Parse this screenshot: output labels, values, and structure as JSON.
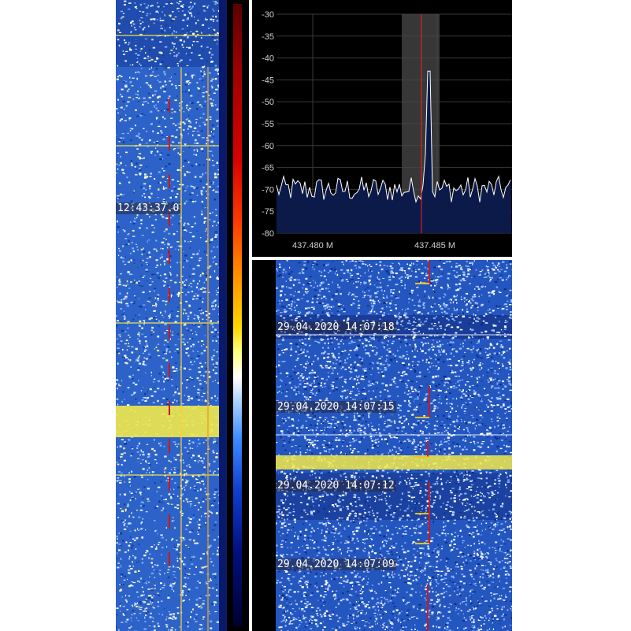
{
  "left_waterfall": {
    "timestamp": "12:43:37.0"
  },
  "spectrum": {
    "y_ticks": [
      "-30",
      "-35",
      "-40",
      "-45",
      "-50",
      "-55",
      "-60",
      "-65",
      "-70",
      "-75",
      "-80"
    ],
    "x_ticks": [
      "437.480 M",
      "437.485 M"
    ],
    "colors": {
      "background": "#000000",
      "trace": "#ffffff",
      "center_marker": "#e02020",
      "filter_band": "#555555",
      "noise_fill": "#0c1a4a"
    }
  },
  "right_waterfall": {
    "timestamps": [
      "29.04.2020 14:07:18",
      "29.04.2020 14:07:15",
      "29.04.2020 14:07:12",
      "29.04.2020 14:07:09"
    ]
  },
  "colorbar": {
    "colors": [
      "#5a0000",
      "#d80000",
      "#ff8a00",
      "#ffff80",
      "#ffffff",
      "#3a8aff",
      "#001080"
    ]
  }
}
